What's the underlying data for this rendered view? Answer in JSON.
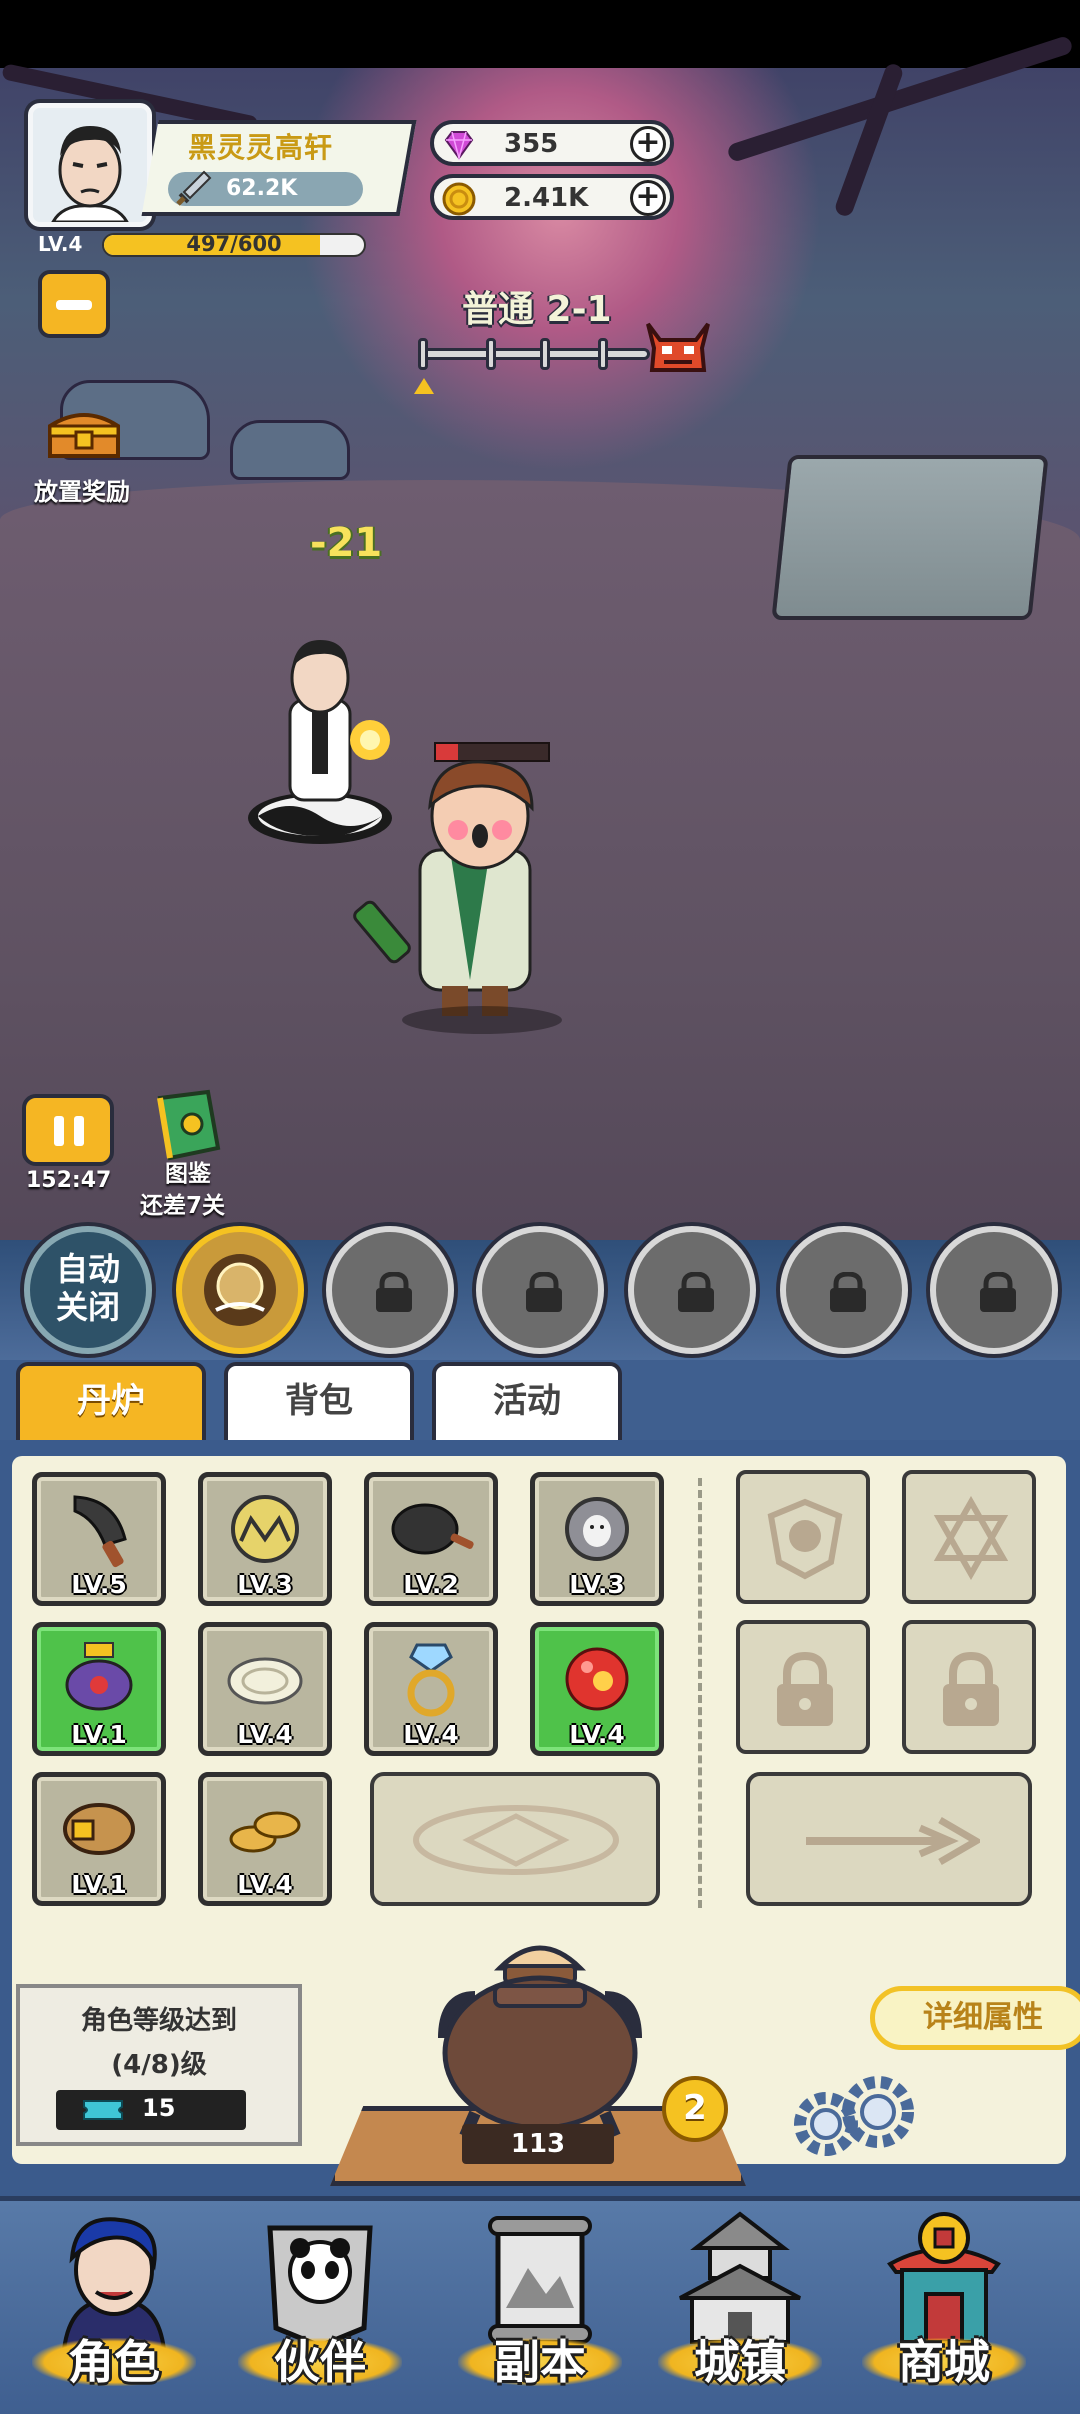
{
  "player": {
    "name": "黑灵灵高轩",
    "power": "62.2K",
    "level_label": "LV.4",
    "xp_text": "497/600",
    "xp_fraction": 0.83
  },
  "currency": {
    "gems": "355",
    "gold": "2.41K",
    "plus_symbol": "+"
  },
  "afk_reward_label": "放置奖励",
  "stage": {
    "title": "普通 2-1"
  },
  "battle": {
    "damage_text": "-21",
    "enemy_hp_fraction": 0.2
  },
  "timer": "152:47",
  "codex": {
    "label": "图鉴",
    "sub": "还差7关"
  },
  "auto_button": {
    "line1": "自动",
    "line2": "关闭"
  },
  "tabs": [
    {
      "label": "丹炉",
      "active": true
    },
    {
      "label": "背包",
      "active": false
    },
    {
      "label": "活动",
      "active": false
    }
  ],
  "items": [
    {
      "icon": "cleaver-icon",
      "level": "LV.5"
    },
    {
      "icon": "gold-orb-icon",
      "level": "LV.3"
    },
    {
      "icon": "wok-icon",
      "level": "LV.2"
    },
    {
      "icon": "dog-coin-icon",
      "level": "LV.3"
    },
    {
      "icon": "purple-robot-icon",
      "level": "LV.1",
      "highlight": true
    },
    {
      "icon": "plate-icon",
      "level": "LV.4"
    },
    {
      "icon": "diamond-ring-icon",
      "level": "LV.4"
    },
    {
      "icon": "red-orb-icon",
      "level": "LV.4",
      "highlight": true
    },
    {
      "icon": "belt-icon",
      "level": "LV.1"
    },
    {
      "icon": "coins-icon",
      "level": "LV.4"
    }
  ],
  "quest": {
    "line1": "角色等级达到",
    "line2": "(4/8)级",
    "reward": "15"
  },
  "detail_button": "详细属性",
  "furnace": {
    "count": "113",
    "level": "2"
  },
  "nav": [
    {
      "label": "角色",
      "icon": "character-icon"
    },
    {
      "label": "伙伴",
      "icon": "partner-icon"
    },
    {
      "label": "副本",
      "icon": "dungeon-scroll-icon"
    },
    {
      "label": "城镇",
      "icon": "town-icon"
    },
    {
      "label": "商城",
      "icon": "shop-icon"
    }
  ],
  "colors": {
    "accent": "#f5b623",
    "panel": "#f4f2dc",
    "nav_bg": "#4f6f9f"
  }
}
